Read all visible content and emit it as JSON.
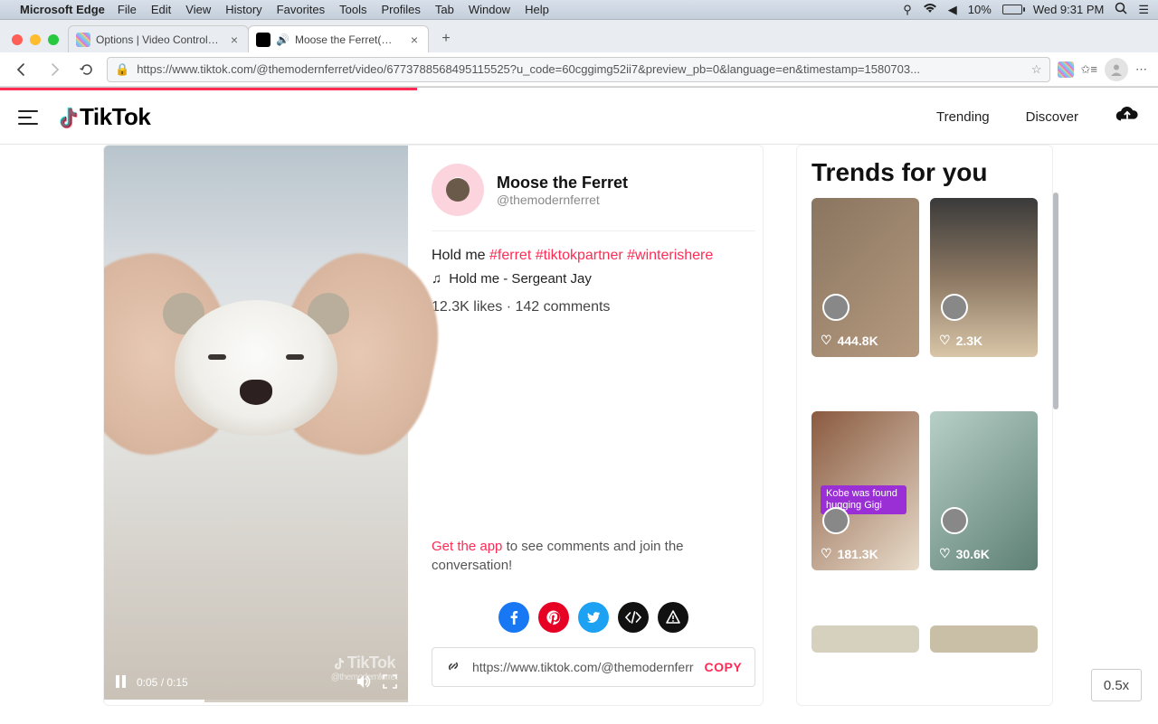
{
  "mac": {
    "app": "Microsoft Edge",
    "menus": [
      "File",
      "Edit",
      "View",
      "History",
      "Favorites",
      "Tools",
      "Profiles",
      "Tab",
      "Window",
      "Help"
    ],
    "battery_pct": "10%",
    "clock": "Wed 9:31 PM"
  },
  "tabs": [
    {
      "title": "Options | Video Controls for Ti"
    },
    {
      "title": "Moose the Ferret(@themo"
    }
  ],
  "addr": {
    "url": "https://www.tiktok.com/@themodernferret/video/6773788568495115525?u_code=60cggimg52ii7&preview_pb=0&language=en&timestamp=1580703..."
  },
  "tt_header": {
    "brand": "TikTok",
    "nav_trending": "Trending",
    "nav_discover": "Discover"
  },
  "video": {
    "current": "0:05",
    "duration": "0:15",
    "watermark": "TikTok",
    "wm_handle": "@themodernferret"
  },
  "post": {
    "author_name": "Moose the Ferret",
    "author_handle": "@themodernferret",
    "caption_text": "Hold me ",
    "tags": [
      "#ferret",
      "#tiktokpartner",
      "#winterishere"
    ],
    "music_label": "Hold me - Sergeant Jay",
    "stats": "12.3K likes · 142 comments",
    "cta_link": "Get the app",
    "cta_rest": " to see comments and join the conversation!",
    "share_url": "https://www.tiktok.com/@themodernferr",
    "copy_label": "COPY"
  },
  "trends": {
    "title": "Trends for you",
    "items": [
      {
        "likes": "444.8K",
        "chip": ""
      },
      {
        "likes": "2.3K",
        "chip": ""
      },
      {
        "likes": "181.3K",
        "chip": "Kobe was found hugging Gigi"
      },
      {
        "likes": "30.6K",
        "chip": ""
      }
    ]
  },
  "zoom": "0.5x"
}
